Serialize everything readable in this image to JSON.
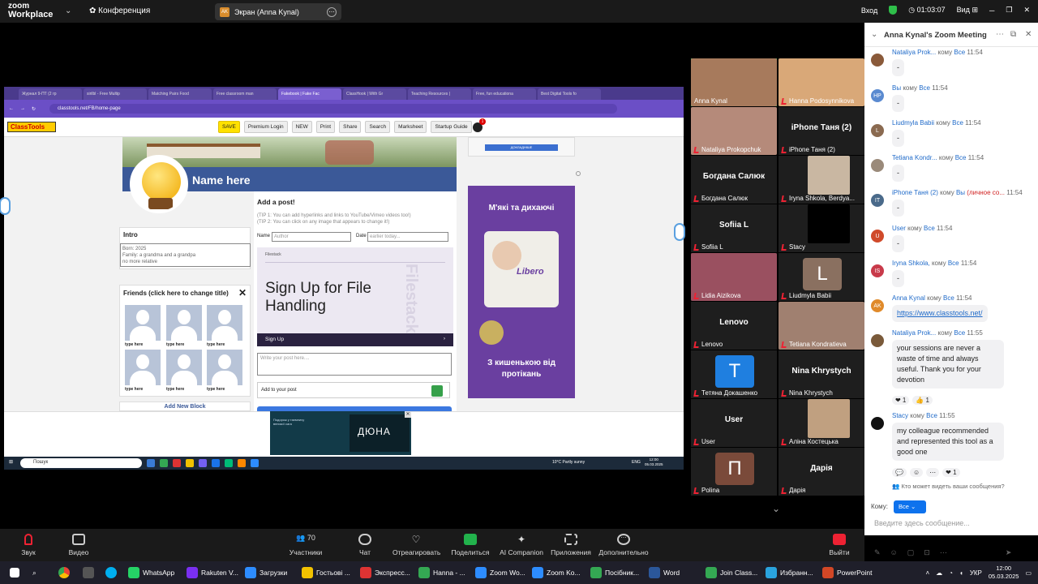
{
  "topbar": {
    "logo_line1": "zoom",
    "logo_line2": "Workplace",
    "conference": "Конференция",
    "share_label": "Экран (Anna Kynal)",
    "share_avatar": "AK",
    "login": "Вход",
    "timer": "01:03:07",
    "view": "Вид"
  },
  "browser": {
    "tabs": [
      "Журнал 9-ПТ (2 гр",
      "sirilbl - Free Multip",
      "Matching Pairs Food",
      "Free classroom man",
      "Fakebook | Fake Fac",
      "ClassHook | With Gr",
      "Teaching Resources |",
      "Free, fun educationa",
      "Best Digital Tools fo"
    ],
    "url": "classtools.net/FB/home-page"
  },
  "classtools": {
    "logo": "ClassTools",
    "menu": [
      "SAVE",
      "Premium Login",
      "NEW",
      "Print",
      "Share",
      "Search",
      "Marksheet",
      "Startup Guide"
    ],
    "bell_count": "1",
    "name": "Name here",
    "intro_title": "Intro",
    "intro_text": "Born: 2025\nFamily: a grandma and a grandpa\nno more relative",
    "friends_title": "Friends (click here to change title)",
    "friend_label": "type here",
    "add_block": "Add New Block",
    "post_title": "Add a post!",
    "tip1": "(TIP 1: You can add hyperlinks and links to YouTube/Vimeo videos too!)",
    "tip2": "(TIP 2: You can click on any image that appears to change it!)",
    "name_label": "Name",
    "name_placeholder": "Author",
    "date_label": "Date",
    "date_placeholder": "earlier today...",
    "post_placeholder": "Write your post here....",
    "add_to_post": "Add to your post",
    "adtop_btn": "ДОКЛАДНІШЕ"
  },
  "ads": {
    "filestack_small": "Filestack",
    "filestack_big": "Sign Up for File Handling",
    "filestack_wm": "Filestack",
    "filestack_btn": "Sign Up",
    "libero_top": "М'які та дихаючі",
    "libero_brand": "Libero",
    "libero_bottom": "З кишенькою від протікань",
    "video_left": "Подорож у таємничу великої сага",
    "video_title": "ДЮНА"
  },
  "inner_taskbar": {
    "search": "Пошук",
    "weather": "10°C Partly sunny",
    "lang": "ENG",
    "time": "12:00",
    "date": "05.03.2025"
  },
  "participants": [
    {
      "name": "Anna Kynal",
      "muted": false
    },
    {
      "name": "Hanna Podosynnikova",
      "muted": true
    },
    {
      "name": "Nataliya Prokopchuk",
      "muted": true
    },
    {
      "name": "iPhone Таня (2)",
      "muted": true,
      "big": "iPhone Таня (2)"
    },
    {
      "name": "Богдана Салюк",
      "muted": true,
      "big": "Богдана Салюк"
    },
    {
      "name": "Iryna Shkola,   Berdya...",
      "muted": true
    },
    {
      "name": "Sofiia L",
      "muted": true,
      "big": "Sofiia L"
    },
    {
      "name": "Stacy",
      "muted": true
    },
    {
      "name": "Lidia Aizikova",
      "muted": true
    },
    {
      "name": "Liudmyla Babii",
      "muted": true,
      "letter": "L"
    },
    {
      "name": "Lenovo",
      "muted": true,
      "big": "Lenovo"
    },
    {
      "name": "Tetiana Kondratieva",
      "muted": true
    },
    {
      "name": "Тетяна Докашенко",
      "muted": true,
      "letter": "T"
    },
    {
      "name": "Nina Khrystych",
      "muted": true,
      "big": "Nina Khrystych"
    },
    {
      "name": "User",
      "muted": true,
      "big": "User"
    },
    {
      "name": "Аліна Костецька",
      "muted": true
    },
    {
      "name": "Polina",
      "muted": true,
      "letter": "П"
    },
    {
      "name": "Дарія",
      "muted": true,
      "big": "Дарія"
    }
  ],
  "chat": {
    "title": "Anna Kynal's Zoom Meeting",
    "messages": [
      {
        "who": "Nataliya Prok...",
        "to_word": "кому",
        "to": "Все",
        "time": "11:54",
        "text": "-"
      },
      {
        "who": "Вы",
        "to_word": "кому",
        "to": "Все",
        "time": "11:54",
        "text": "-",
        "avatar": "HP"
      },
      {
        "who": "Liudmyla Babii",
        "to_word": "кому",
        "to": "Все",
        "time": "11:54",
        "text": "-",
        "avatar": "L"
      },
      {
        "who": "Tetiana Kondr...",
        "to_word": "кому",
        "to": "Все",
        "time": "11:54",
        "text": "-"
      },
      {
        "who": "iPhone Таня (2)",
        "to_word": "кому",
        "to": "Вы",
        "priv": "(личное со...",
        "time": "11:54",
        "text": "-",
        "avatar": "IT"
      },
      {
        "who": "User",
        "to_word": "кому",
        "to": "Все",
        "time": "11:54",
        "text": "-",
        "avatar": "U"
      },
      {
        "who": "Iryna Shkola,",
        "to_word": "кому",
        "to": "Все",
        "time": "11:54",
        "text": "-",
        "avatar": "IS"
      },
      {
        "who": "Anna Kynal",
        "to_word": "кому",
        "to": "Все",
        "time": "11:54",
        "text": "https://www.classtools.net/",
        "avatar": "AK"
      },
      {
        "who": "Nataliya Prok...",
        "to_word": "кому",
        "to": "Все",
        "time": "11:55",
        "text": "your sessions are never a waste of time and always useful. Thank you for your devotion"
      },
      {
        "who": "Stacy",
        "to_word": "кому",
        "to": "Все",
        "time": "11:55",
        "text": "my colleague recommended and represented this tool as a good one"
      }
    ],
    "reactions1": [
      "❤ 1",
      "👍 1"
    ],
    "reactions2": [
      "❤ 1"
    ],
    "who_sees": "Кто может видеть ваши сообщения?",
    "komu": "Кому:",
    "komu_value": "Все",
    "input_placeholder": "Введите здесь сообщение..."
  },
  "toolbar": {
    "audio": "Звук",
    "video": "Видео",
    "participants": "Участники",
    "participants_count": "70",
    "chat": "Чат",
    "react": "Отреагировать",
    "share": "Поделиться",
    "ai": "AI Companion",
    "apps": "Приложения",
    "more": "Дополнительно",
    "leave": "Выйти"
  },
  "taskbar": {
    "items": [
      "WhatsApp",
      "Rakuten V...",
      "Загрузки",
      "Гостьові ...",
      "Экспресс...",
      "Hanna - ...",
      "Zoom Wo...",
      "Zoom Ko...",
      "Посібник...",
      "Word",
      "Join Class...",
      "Избранн...",
      "PowerPoint"
    ],
    "lang": "УКР",
    "time": "12:00",
    "date": "05.03.2025"
  }
}
